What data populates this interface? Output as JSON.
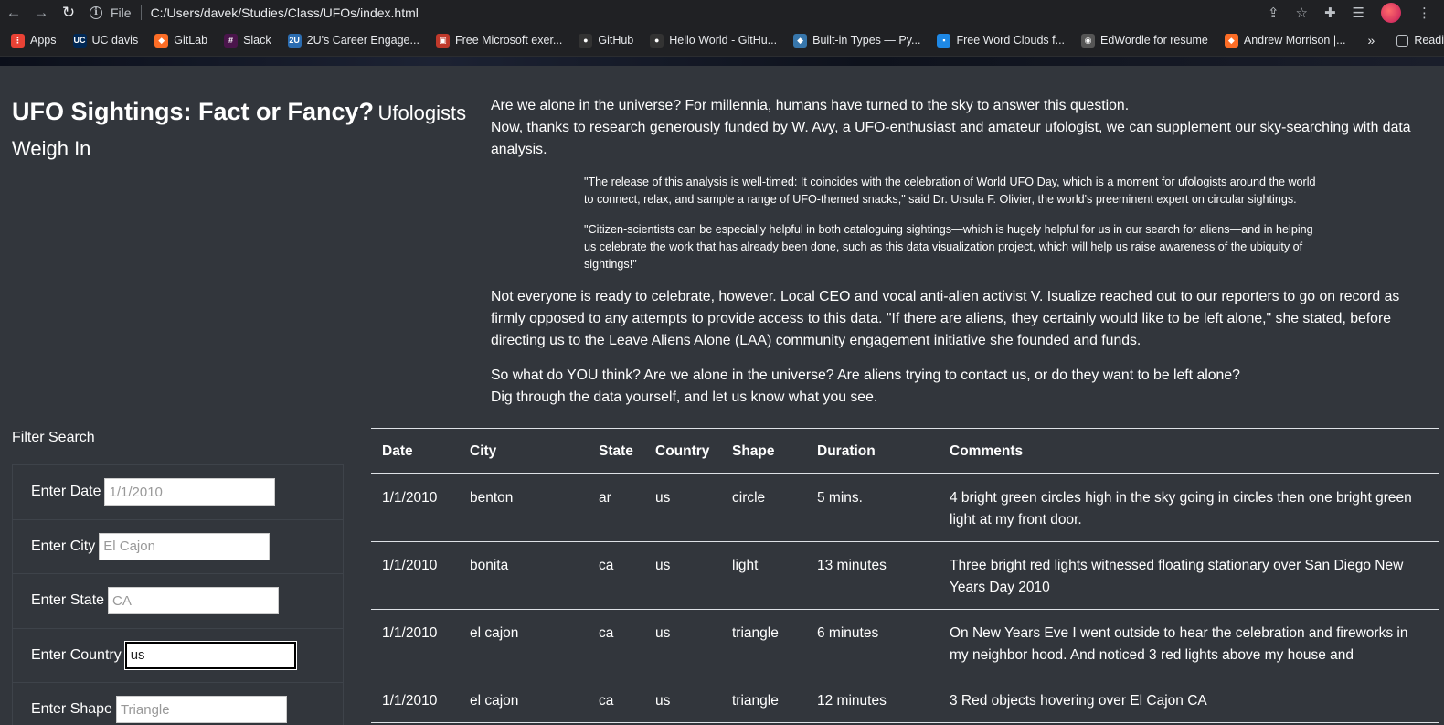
{
  "browser": {
    "url_label": "File",
    "url": "C:/Users/davek/Studies/Class/UFOs/index.html",
    "bookmarks": [
      {
        "label": "Apps",
        "color": "#e94235",
        "glyph": "⋮"
      },
      {
        "label": "UC davis",
        "color": "#002855",
        "glyph": "UC"
      },
      {
        "label": "GitLab",
        "color": "#fc6d26",
        "glyph": "◆"
      },
      {
        "label": "Slack",
        "color": "#4a154b",
        "glyph": "#"
      },
      {
        "label": "2U's Career Engage...",
        "color": "#2b6cb0",
        "glyph": "2U"
      },
      {
        "label": "Free Microsoft exer...",
        "color": "#c0392b",
        "glyph": "▣"
      },
      {
        "label": "GitHub",
        "color": "#333333",
        "glyph": "●"
      },
      {
        "label": "Hello World - GitHu...",
        "color": "#333333",
        "glyph": "●"
      },
      {
        "label": "Built-in Types — Py...",
        "color": "#3776ab",
        "glyph": "◆"
      },
      {
        "label": "Free Word Clouds f...",
        "color": "#1e88e5",
        "glyph": "▪"
      },
      {
        "label": "EdWordle for resume",
        "color": "#555555",
        "glyph": "◉"
      },
      {
        "label": "Andrew Morrison |...",
        "color": "#fc6d26",
        "glyph": "◆"
      }
    ],
    "more": "»",
    "reading_list": "Reading lis"
  },
  "header": {
    "title": "UFO Sightings: Fact or Fancy?",
    "subtitle": "Ufologists Weigh In"
  },
  "intro": {
    "p1_line1": "Are we alone in the universe? For millennia, humans have turned to the sky to answer this question.",
    "p1_line2": "Now, thanks to research generously funded by W. Avy, a UFO-enthusiast and amateur ufologist, we can supplement our sky-searching with data analysis.",
    "quote1": "\"The release of this analysis is well-timed: It coincides with the celebration of World UFO Day, which is a moment for ufologists around the world to connect, relax, and sample a range of UFO-themed snacks,\" said Dr. Ursula F. Olivier, the world's preeminent expert on circular sightings.",
    "quote2": "\"Citizen-scientists can be especially helpful in both cataloguing sightings—which is hugely helpful for us in our search for aliens—and in helping us celebrate the work that has already been done, such as this data visualization project, which will help us raise awareness of the ubiquity of sightings!\"",
    "p2": "Not everyone is ready to celebrate, however. Local CEO and vocal anti-alien activist V. Isualize reached out to our reporters to go on record as firmly opposed to any attempts to provide access to this data. \"If there are aliens, they certainly would like to be left alone,\" she stated, before directing us to the Leave Aliens Alone (LAA) community engagement initiative she founded and funds.",
    "p3_line1": "So what do YOU think? Are we alone in the universe? Are aliens trying to contact us, or do they want to be left alone?",
    "p3_line2": "Dig through the data yourself, and let us know what you see."
  },
  "filters": {
    "title": "Filter Search",
    "items": [
      {
        "label": "Enter Date",
        "placeholder": "1/1/2010",
        "value": ""
      },
      {
        "label": "Enter City",
        "placeholder": "El Cajon",
        "value": ""
      },
      {
        "label": "Enter State",
        "placeholder": "CA",
        "value": ""
      },
      {
        "label": "Enter Country",
        "placeholder": "",
        "value": "us"
      },
      {
        "label": "Enter Shape",
        "placeholder": "Triangle",
        "value": ""
      }
    ]
  },
  "table": {
    "headers": [
      "Date",
      "City",
      "State",
      "Country",
      "Shape",
      "Duration",
      "Comments"
    ],
    "rows": [
      [
        "1/1/2010",
        "benton",
        "ar",
        "us",
        "circle",
        "5 mins.",
        "4 bright green circles high in the sky going in circles then one bright green light at my front door."
      ],
      [
        "1/1/2010",
        "bonita",
        "ca",
        "us",
        "light",
        "13 minutes",
        "Three bright red lights witnessed floating stationary over San Diego New Years Day 2010"
      ],
      [
        "1/1/2010",
        "el cajon",
        "ca",
        "us",
        "triangle",
        "6 minutes",
        "On New Years Eve I went outside to hear the celebration and fireworks in my neighbor hood. And noticed 3 red lights above my house and"
      ],
      [
        "1/1/2010",
        "el cajon",
        "ca",
        "us",
        "triangle",
        "12 minutes",
        "3 Red objects hovering over El Cajon CA"
      ]
    ]
  }
}
